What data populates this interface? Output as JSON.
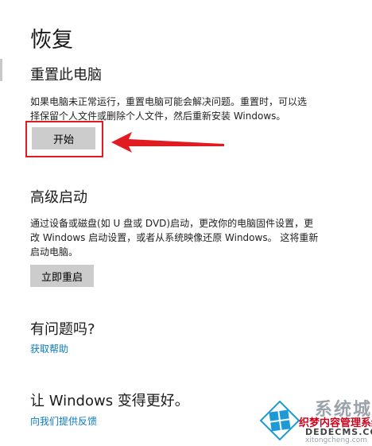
{
  "page": {
    "title": "恢复"
  },
  "reset": {
    "title": "重置此电脑",
    "description_line1": "如果电脑未正常运行，重置电脑可能会解决问题。重置时，可以选",
    "description_line2": "择保留个人文件或删除个人文件，然后重新安装 Windows。",
    "button_label": "开始"
  },
  "advanced": {
    "title": "高级启动",
    "description_line1": "通过设备或磁盘(如 U 盘或 DVD)启动，更改你的电脑固件设置，更",
    "description_line2": "改 Windows 启动设置，或者从系统映像还原 Windows。 这将重新",
    "description_line3": "启动电脑。",
    "button_label": "立即重启"
  },
  "help": {
    "title": "有问题吗?",
    "link_label": "获取帮助"
  },
  "feedback": {
    "title": "让 Windows 变得更好。",
    "link_label": "向我们提供反馈"
  },
  "watermark": {
    "line1": "织梦内容管理系统",
    "line2": "DEDECMS.COM",
    "line3": "xitongcheng.com",
    "brand": "系统城"
  },
  "colors": {
    "link": "#0a7bbf",
    "highlight": "#e11b22",
    "button": "#cccccc",
    "windows_logo": "#1d9ad6"
  }
}
